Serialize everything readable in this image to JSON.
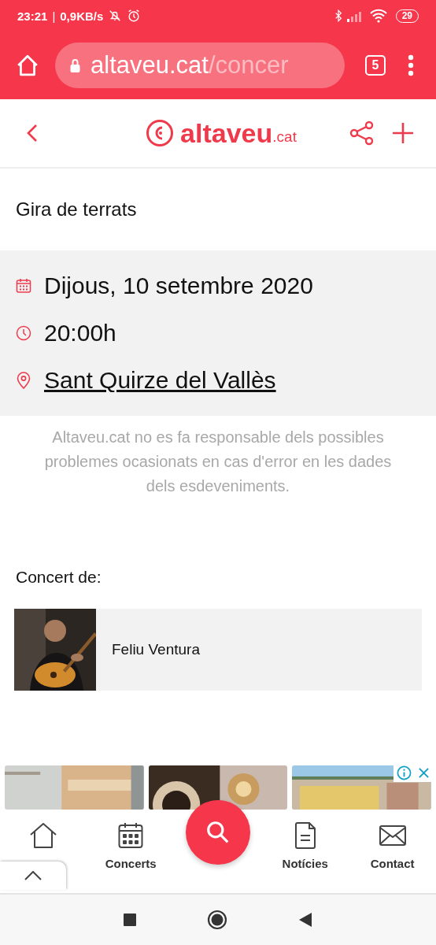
{
  "status_bar": {
    "time": "23:21",
    "separator": "|",
    "speed": "0,9KB/s",
    "battery": "29"
  },
  "browser": {
    "domain": "altaveu.cat",
    "path": "/concer",
    "tab_count": "5"
  },
  "header": {
    "logo_name": "altaveu",
    "logo_suffix": ".cat"
  },
  "title": "Gira de terrats",
  "details": [
    {
      "kind": "date",
      "text": "Dijous, 10 setembre 2020",
      "link": false
    },
    {
      "kind": "time",
      "text": "20:00h",
      "link": false
    },
    {
      "kind": "place",
      "text": "Sant Quirze del Vallès",
      "link": true
    }
  ],
  "disclaimer": "Altaveu.cat no es fa responsable dels possibles problemes ocasionats en cas d'error en les dades dels esdeveniments.",
  "section_heading": "Concert de:",
  "artists": [
    {
      "name": "Feliu Ventura"
    }
  ],
  "ad": {
    "pictures": [
      {
        "kind": "room"
      },
      {
        "kind": "lamp"
      },
      {
        "kind": "city"
      }
    ]
  },
  "bottom_nav": [
    {
      "kind": "home"
    },
    {
      "kind": "calendar",
      "label": "Concerts"
    },
    {
      "kind": "search"
    },
    {
      "kind": "document",
      "label": "Notícies"
    },
    {
      "kind": "mail",
      "label": "Contact"
    }
  ]
}
